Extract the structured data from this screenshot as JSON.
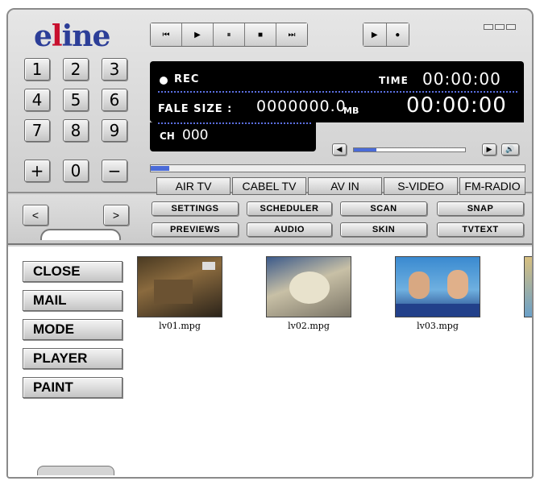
{
  "logo": {
    "part1": "e",
    "part2": "l",
    "part3": "ine"
  },
  "transport": [
    "⏮",
    "▶",
    "⏸",
    "■",
    "⏭"
  ],
  "rec_controls": [
    "▶",
    "●"
  ],
  "numpad": [
    "1",
    "2",
    "3",
    "4",
    "5",
    "6",
    "7",
    "8",
    "9",
    "+",
    "0",
    "−"
  ],
  "lcd": {
    "rec_label": "REC",
    "time_label": "TIME",
    "time_value": "00:00:00",
    "file_size_label": "FALE SIZE :",
    "file_size_value": "0000000.0",
    "file_size_unit": "MB",
    "elapsed": "00:00:00",
    "ch_label": "CH",
    "ch_value": "000"
  },
  "volume_level": 0.2,
  "progress_level": 0.05,
  "sources": [
    "AIR TV",
    "CABEL TV",
    "AV IN",
    "S-VIDEO",
    "FM-RADIO"
  ],
  "nav": {
    "prev": "<",
    "next": ">"
  },
  "menu": {
    "row1": [
      "SETTINGS",
      "SCHEDULER",
      "SCAN",
      "SNAP"
    ],
    "row2": [
      "PREVIEWS",
      "AUDIO",
      "SKIN",
      "TVTEXT"
    ]
  },
  "side_buttons": [
    "CLOSE",
    "MAIL",
    "MODE",
    "PLAYER",
    "PAINT"
  ],
  "files": [
    "lv01.mpg",
    "lv02.mpg",
    "lv03.mpg"
  ],
  "colors": {
    "accent_blue": "#4a6bd8",
    "logo_blue": "#2c3e98",
    "logo_red": "#c8102e"
  }
}
